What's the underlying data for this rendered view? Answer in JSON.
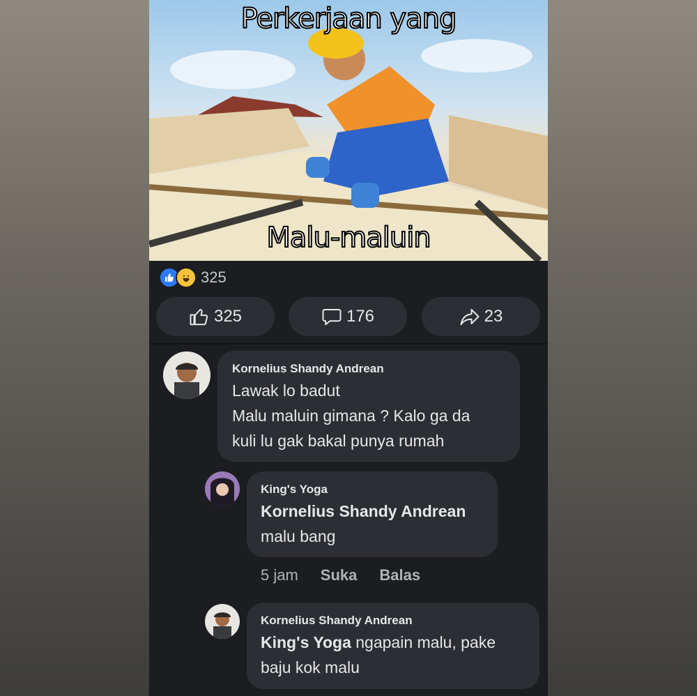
{
  "meme": {
    "caption_top": "Perkerjaan yang",
    "caption_bottom": "Malu-maluin"
  },
  "reactions": {
    "icons": [
      "like-icon",
      "haha-icon"
    ],
    "count": "325"
  },
  "actions": {
    "like_count": "325",
    "comment_count": "176",
    "share_count": "23"
  },
  "comments": [
    {
      "author": "Kornelius Shandy Andrean",
      "lines": [
        "Lawak lo badut",
        "Malu maluin gimana ? Kalo ga da",
        "kuli lu gak bakal punya rumah"
      ]
    },
    {
      "author": "King's Yoga",
      "mention": "Kornelius Shandy Andrean",
      "text": "malu bang",
      "time": "5 jam",
      "like_label": "Suka",
      "reply_label": "Balas"
    },
    {
      "author": "Kornelius Shandy Andrean",
      "mention": "King's Yoga",
      "text_first": " ngapain malu, pake",
      "text_second": "baju kok malu"
    }
  ],
  "colors": {
    "panel": "#1c1d21",
    "bubble": "#2c2e33",
    "like_blue": "#2a7cf6",
    "haha_yellow": "#f5c33b"
  }
}
